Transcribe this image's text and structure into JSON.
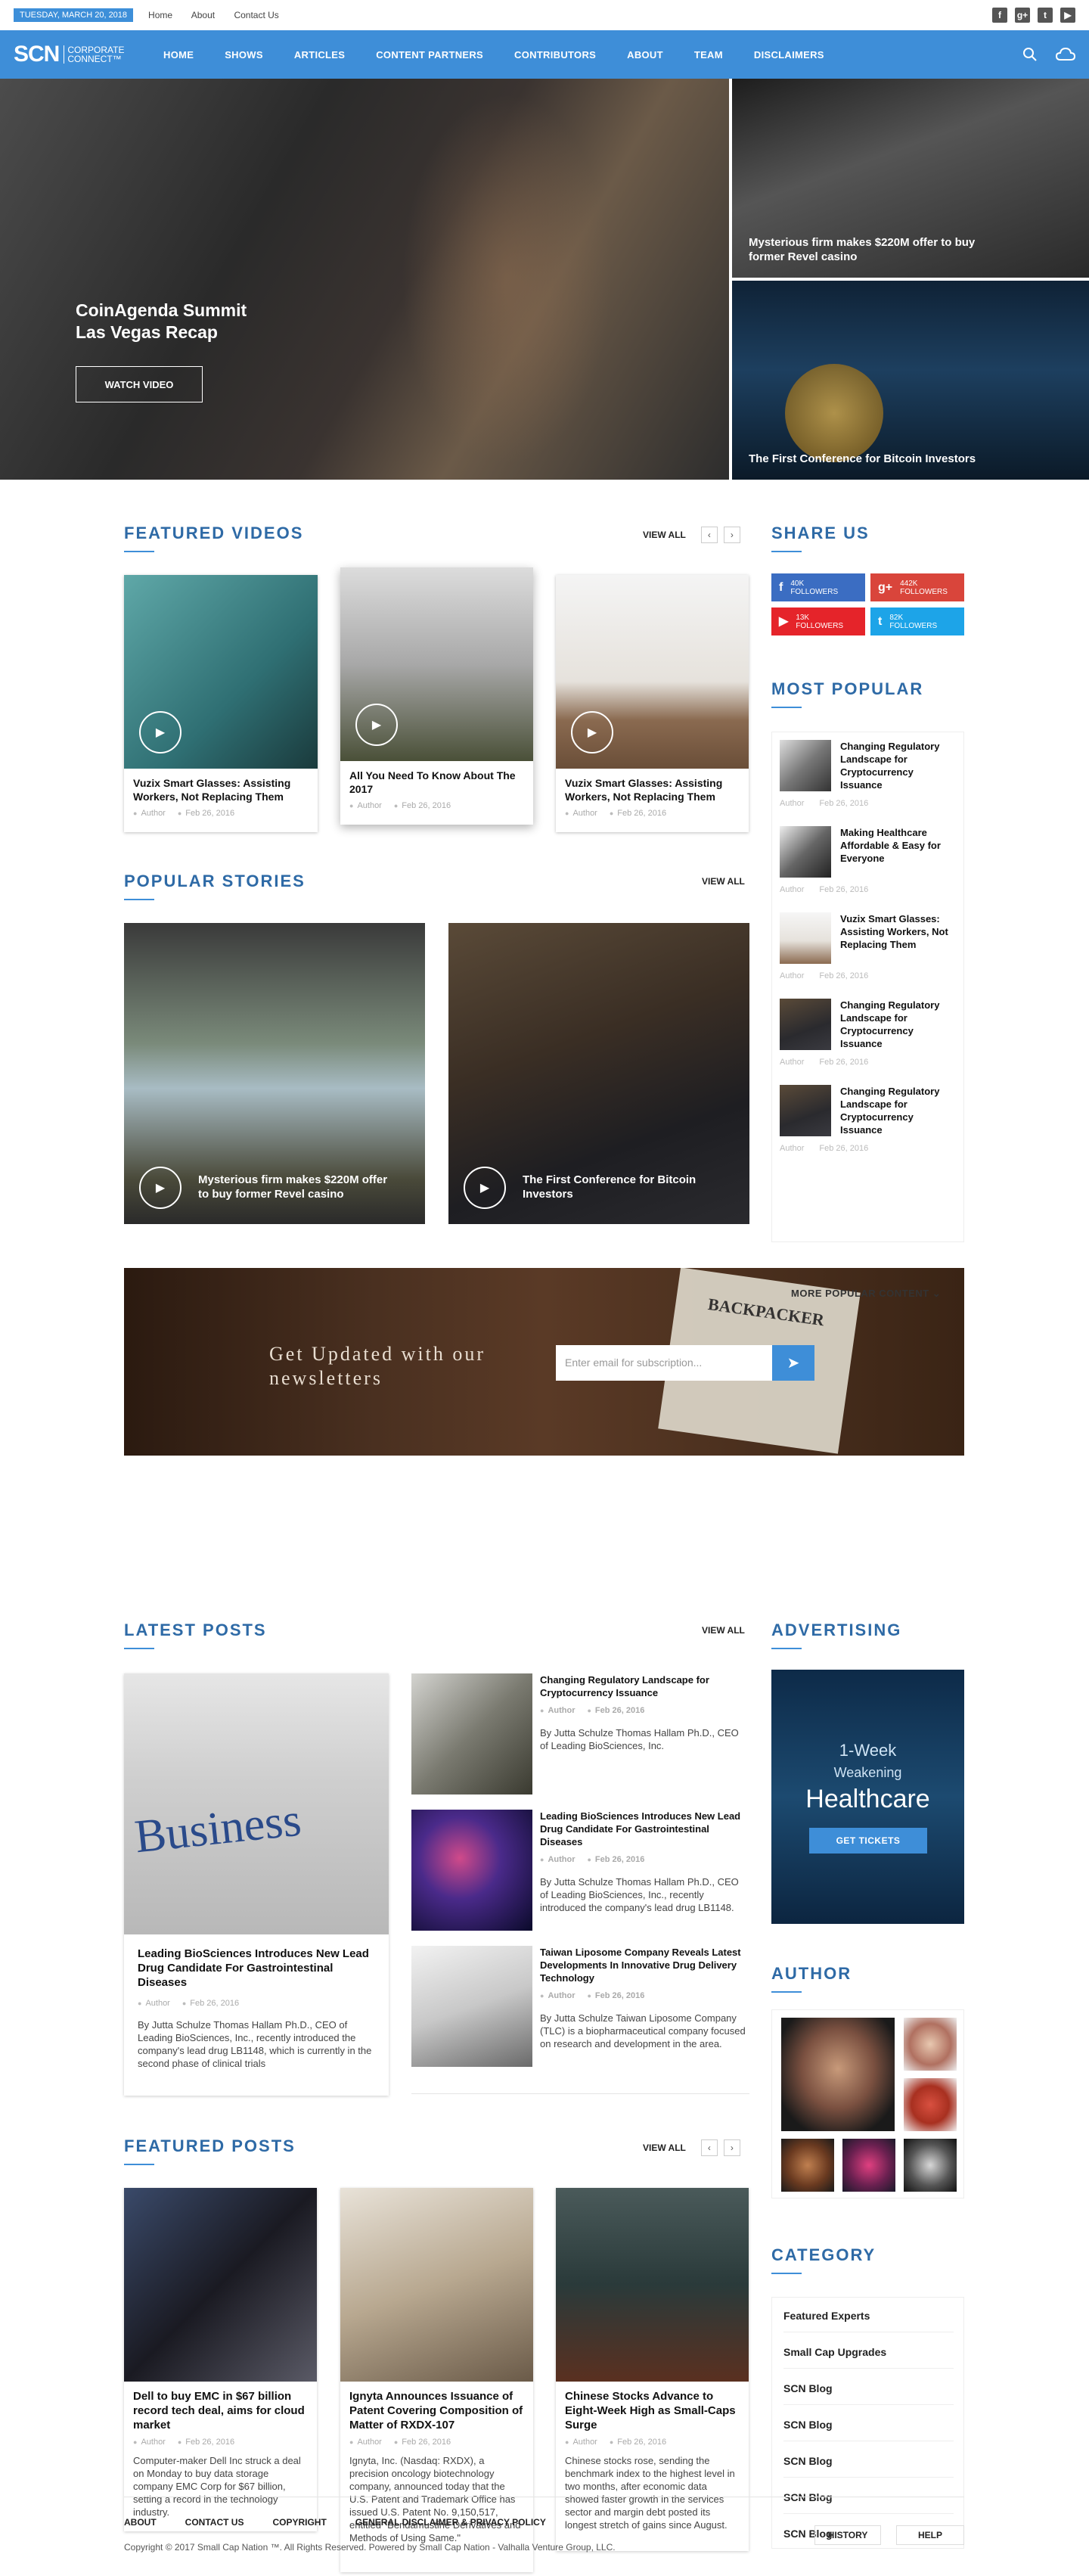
{
  "topbar": {
    "date": "TUESDAY, MARCH 20, 2018",
    "links": [
      "Home",
      "About",
      "Contact Us"
    ],
    "social": [
      "f",
      "g+",
      "t",
      "▶"
    ]
  },
  "nav": {
    "logo": "SCN",
    "logo_sub1": "CORPORATE",
    "logo_sub2": "CONNECT™",
    "items": [
      "HOME",
      "SHOWS",
      "ARTICLES",
      "CONTENT PARTNERS",
      "CONTRIBUTORS",
      "ABOUT",
      "TEAM",
      "DISCLAIMERS"
    ]
  },
  "hero": {
    "title1": "CoinAgenda Summit",
    "title2": "Las Vegas Recap",
    "button": "WATCH VIDEO",
    "side1": "Mysterious firm makes $220M offer to buy former Revel casino",
    "side2": "The First Conference for Bitcoin Investors"
  },
  "featured_videos": {
    "title": "FEATURED VIDEOS",
    "view_all": "VIEW ALL",
    "cards": [
      {
        "title": "Vuzix Smart Glasses: Assisting Workers, Not Replacing Them",
        "author": "Author",
        "date": "Feb 26, 2016"
      },
      {
        "title": "All You Need To Know About The 2017",
        "author": "Author",
        "date": "Feb 26, 2016"
      },
      {
        "title": "Vuzix Smart Glasses: Assisting Workers, Not Replacing Them",
        "author": "Author",
        "date": "Feb 26, 2016"
      }
    ]
  },
  "share": {
    "title": "SHARE US",
    "buttons": [
      {
        "icon": "f",
        "count": "40K",
        "label": "FOLLOWERS",
        "color": "#3b6dc2"
      },
      {
        "icon": "g+",
        "count": "442K",
        "label": "FOLLOWERS",
        "color": "#d9453b"
      },
      {
        "icon": "▶",
        "count": "13K",
        "label": "FOLLOWERS",
        "color": "#e5242a"
      },
      {
        "icon": "t",
        "count": "82K",
        "label": "FOLLOWERS",
        "color": "#1da4e8"
      }
    ]
  },
  "most_popular": {
    "title": "MOST POPULAR",
    "more": "MORE POPULAR CONTENT",
    "items": [
      {
        "title": "Changing Regulatory Landscape for Cryptocurrency Issuance",
        "author": "Author",
        "date": "Feb 26, 2016"
      },
      {
        "title": "Making Healthcare Affordable & Easy for Everyone",
        "author": "Author",
        "date": "Feb 26, 2016"
      },
      {
        "title": "Vuzix Smart Glasses: Assisting Workers, Not Replacing Them",
        "author": "Author",
        "date": "Feb 26, 2016"
      },
      {
        "title": "Changing Regulatory Landscape for Cryptocurrency Issuance",
        "author": "Author",
        "date": "Feb 26, 2016"
      },
      {
        "title": "Changing Regulatory Landscape for Cryptocurrency Issuance",
        "author": "Author",
        "date": "Feb 26, 2016"
      }
    ]
  },
  "popular_stories": {
    "title": "POPULAR STORIES",
    "view_all": "VIEW ALL",
    "items": [
      "Mysterious firm makes $220M offer to buy former Revel casino",
      "The First Conference for Bitcoin Investors"
    ]
  },
  "newsletter": {
    "title1": "Get Updated with our",
    "title2": "newsletters",
    "placeholder": "Enter email for subscription...",
    "paper": "BACKPACKER"
  },
  "latest_posts": {
    "title": "LATEST POSTS",
    "view_all": "VIEW ALL",
    "big": {
      "title": "Leading BioSciences Introduces New Lead Drug Candidate For Gastrointestinal Diseases",
      "author": "Author",
      "date": "Feb 26, 2016",
      "desc": "By Jutta Schulze Thomas Hallam Ph.D., CEO of Leading BioSciences, Inc., recently introduced the company's lead drug LB1148, which is currently in the second phase of clinical trials",
      "image_text": "Business"
    },
    "items": [
      {
        "title": "Changing Regulatory Landscape for Cryptocurrency Issuance",
        "author": "Author",
        "date": "Feb 26, 2016",
        "desc": "By Jutta Schulze Thomas Hallam Ph.D., CEO of Leading BioSciences, Inc."
      },
      {
        "title": "Leading BioSciences Introduces New Lead Drug Candidate For Gastrointestinal Diseases",
        "author": "Author",
        "date": "Feb 26, 2016",
        "desc": "By Jutta Schulze Thomas Hallam Ph.D., CEO of Leading BioSciences, Inc., recently introduced the company's lead drug LB1148."
      },
      {
        "title": "Taiwan Liposome Company Reveals Latest Developments In Innovative Drug Delivery Technology",
        "author": "Author",
        "date": "Feb 26, 2016",
        "desc": "By Jutta Schulze Taiwan Liposome Company (TLC) is a biopharmaceutical company focused on research and development in the area."
      }
    ]
  },
  "advertising": {
    "title": "ADVERTISING",
    "line1": "1-Week",
    "line2": "Weakening",
    "line3": "Healthcare",
    "button": "GET TICKETS"
  },
  "author": {
    "title": "AUTHOR"
  },
  "category": {
    "title": "CATEGORY",
    "items": [
      "Featured Experts",
      "Small Cap Upgrades",
      "SCN Blog",
      "SCN Blog",
      "SCN Blog",
      "SCN Blog",
      "SCN Blog"
    ]
  },
  "featured_posts": {
    "title": "FEATURED POSTS",
    "view_all": "VIEW ALL",
    "items": [
      {
        "title": "Dell to buy EMC in $67 billion record tech deal, aims for cloud market",
        "author": "Author",
        "date": "Feb 26, 2016",
        "desc": "Computer-maker Dell Inc struck a deal on Monday to buy data storage company EMC Corp for $67 billion, setting a record in the technology industry."
      },
      {
        "title": "Ignyta Announces Issuance of Patent Covering Composition of Matter of RXDX-107",
        "author": "Author",
        "date": "Feb 26, 2016",
        "desc": "Ignyta, Inc. (Nasdaq: RXDX), a precision oncology biotechnology company, announced today that the U.S. Patent and Trademark Office has issued U.S. Patent No. 9,150,517, entitled \"Bendamustine Derivatives and Methods of Using Same.\""
      },
      {
        "title": "Chinese Stocks Advance to Eight-Week High as Small-Caps Surge",
        "author": "Author",
        "date": "Feb 26, 2016",
        "desc": "Chinese stocks rose, sending the benchmark index to the highest level in two months, after economic data showed faster growth in the services sector and margin debt posted its longest stretch of gains since August."
      }
    ]
  },
  "footer": {
    "links": [
      "ABOUT",
      "CONTACT US",
      "COPYRIGHT",
      "GENERAL DISCLAIMER & PRIVACY POLICY"
    ],
    "copyright": "Copyright © 2017 Small Cap Nation ™. All Rights Reserved. Powered by Small Cap Nation - Valhalla Venture Group, LLC.",
    "history": "HISTORY",
    "help": "HELP"
  }
}
